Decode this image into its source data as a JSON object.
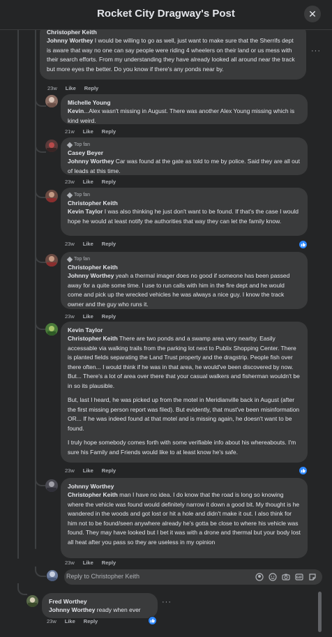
{
  "header": {
    "title": "Rocket City Dragway's Post",
    "close_icon": "close-icon"
  },
  "comments": [
    {
      "author": "Christopher Keith",
      "mention": "Johnny Worthey",
      "text": " I would be willing to go as well, just want to make sure that the Sherrifs dept is aware that way no one can say people were riding 4 wheelers on their land or us mess with their search efforts. From my understanding they have already looked all around near the track but more eyes the better. Do you know if there's any ponds near by.",
      "time": "23w",
      "like": "Like",
      "reply": "Reply"
    },
    {
      "author": "Michelle Young",
      "mention": "Kevin",
      "text": "...Alex wasn't missing in August. There was another Alex Young missing which is kind weird.",
      "time": "21w",
      "like": "Like",
      "reply": "Reply"
    },
    {
      "badge": "Top fan",
      "author": "Casey Beyer",
      "mention": "Johnny Worthey",
      "text": " Car was found at the gate as told to me by police. Said they are all out of leads at this time.",
      "time": "23w",
      "like": "Like",
      "reply": "Reply"
    },
    {
      "badge": "Top fan",
      "author": "Christopher Keith",
      "mention": "Kevin Taylor",
      "text": " I was also thinking he just don't want to be found. If that's the case I would hope he would at least notify the authorities that way they can let the family know.",
      "time": "23w",
      "like": "Like",
      "reply": "Reply"
    },
    {
      "badge": "Top fan",
      "author": "Christopher Keith",
      "mention": "Johnny Worthey",
      "text": " yeah a thermal imager does no good if someone has been passed away for a quite some time. I use to run calls with him in the fire dept and he would come and pick up the wrecked vehicles he was always a nice guy. I know the track owner and the guy who runs it.",
      "time": "23w",
      "like": "Like",
      "reply": "Reply"
    },
    {
      "author": "Kevin Taylor",
      "mention": "Christopher Keith",
      "text": " There are two ponds and a swamp area very nearby. Easily accessable via walking trails from the parking lot next to Publix Shopping Center. There is planted fields separating the Land Trust property and the dragstrip. People fish over there often... I would think if he was in that area, he would've been discovered by now. But... There's a lot of area over there that your casual walkers and fisherman wouldn't be in so its plausible.",
      "text2": "But, last I heard, he was picked up from the motel in Meridianville back in August (after the first missing person report was filed). But evidently, that must've been misinformation OR... If he was indeed found at that motel and is missing again, he doesn't want to be found.",
      "text3": "I truly hope somebody comes forth with some verifiable info about his whereabouts. I'm sure his Family and Friends would like to at least know he's safe.",
      "time": "23w",
      "like": "Like",
      "reply": "Reply"
    },
    {
      "author": "Johnny Worthey",
      "mention": "Christopher Keith",
      "text": " man I have no idea. I do know that the road is long so knowing where the vehicle was found would definitely narrow it down a good bit. My thought is he wandered in the woods and got lost or hit a hole and didn't make it out. I also think for him not to be found/seen anywhere already he's gotta be close to where his vehicle was found. They may have looked but I bet it was with a drone and thermal but your body lost all heat after you pass so they are useless in my opinion",
      "time": "23w",
      "like": "Like",
      "reply": "Reply"
    },
    {
      "author": "Fred Worthey",
      "mention": "Johnny Worthey",
      "text": " ready when ever",
      "time": "23w",
      "like": "Like",
      "reply": "Reply"
    }
  ],
  "reply_box": {
    "placeholder": "Reply to Christopher Keith"
  },
  "icons": {
    "reaction": "like-reaction-icon",
    "more": "more-options-icon",
    "composer": [
      "avatar-sticker-icon",
      "emoji-icon",
      "camera-icon",
      "gif-icon",
      "sticker-icon"
    ]
  },
  "colors": {
    "background": "#242526",
    "bubble": "#3a3b3c",
    "text": "#e4e6eb",
    "muted": "#b0b3b8",
    "like_blue": "#2d88ff"
  }
}
